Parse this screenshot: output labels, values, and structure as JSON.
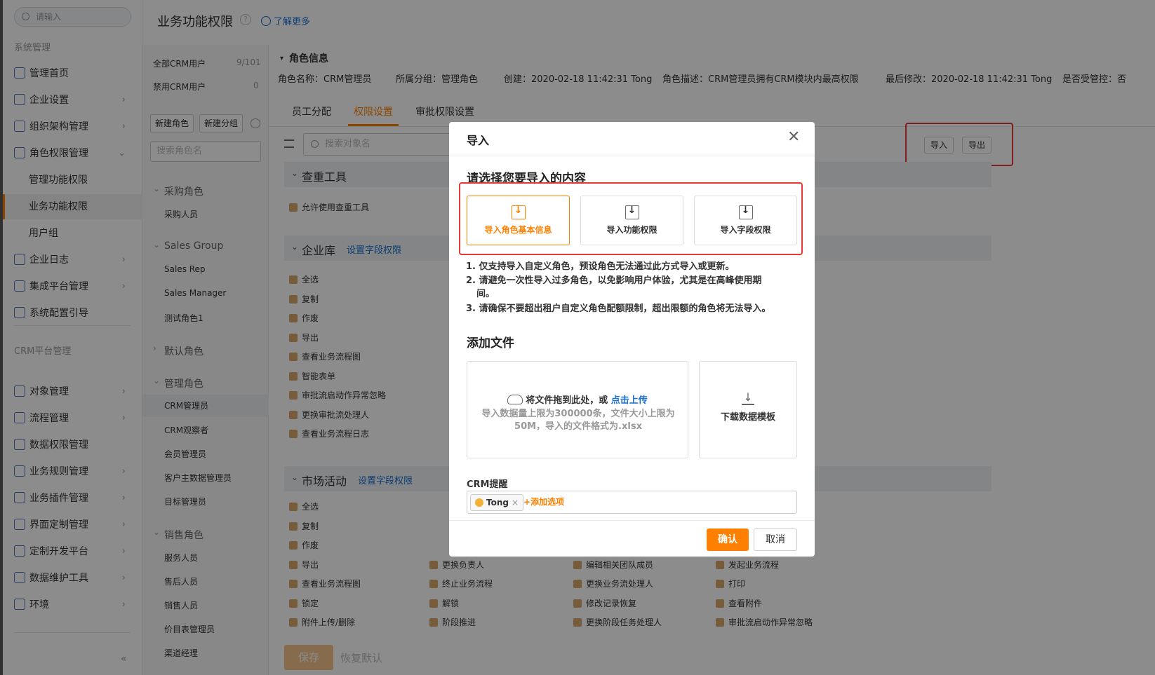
{
  "sidebar": {
    "search_placeholder": "请输入",
    "section1": "系统管理",
    "items1": [
      {
        "label": "管理首页",
        "icon": "home-icon",
        "arrow": ""
      },
      {
        "label": "企业设置",
        "icon": "building-icon",
        "arrow": "›"
      },
      {
        "label": "组织架构管理",
        "icon": "org-chart-icon",
        "arrow": "›"
      },
      {
        "label": "角色权限管理",
        "icon": "role-icon",
        "arrow": "⌄"
      }
    ],
    "subitems": [
      "管理功能权限",
      "业务功能权限",
      "用户组"
    ],
    "items2": [
      {
        "label": "企业日志",
        "icon": "log-icon",
        "arrow": "›"
      },
      {
        "label": "集成平台管理",
        "icon": "integration-icon",
        "arrow": "›"
      },
      {
        "label": "系统配置引导",
        "icon": "guide-icon",
        "arrow": ""
      }
    ],
    "section2": "CRM平台管理",
    "items3": [
      {
        "label": "对象管理",
        "icon": "object-icon",
        "arrow": "›"
      },
      {
        "label": "流程管理",
        "icon": "flow-icon",
        "arrow": "›"
      },
      {
        "label": "数据权限管理",
        "icon": "data-permission-icon",
        "arrow": ""
      },
      {
        "label": "业务规则管理",
        "icon": "rule-icon",
        "arrow": "›"
      },
      {
        "label": "业务插件管理",
        "icon": "plugin-icon",
        "arrow": "›"
      },
      {
        "label": "界面定制管理",
        "icon": "layout-icon",
        "arrow": "›"
      },
      {
        "label": "定制开发平台",
        "icon": "code-icon",
        "arrow": "›"
      },
      {
        "label": "数据维护工具",
        "icon": "chart-icon",
        "arrow": "›"
      },
      {
        "label": "环境",
        "icon": "env-icon",
        "arrow": "›"
      }
    ],
    "collapse": "«"
  },
  "header": {
    "title": "业务功能权限",
    "help": "?",
    "learn_more": "了解更多"
  },
  "col2": {
    "all_users": "全部CRM用户",
    "all_count": "9/101",
    "disabled_users": "禁用CRM用户",
    "disabled_count": "0",
    "new_role": "新建角色",
    "new_group": "新建分组",
    "search_placeholder": "搜索角色名",
    "groups": [
      {
        "name": "采购角色",
        "items": [
          "采购人员"
        ]
      },
      {
        "name": "Sales Group",
        "items": [
          "Sales Rep",
          "Sales Manager",
          "测试角色1"
        ]
      },
      {
        "name": "默认角色",
        "items": []
      },
      {
        "name": "管理角色",
        "items": [
          "CRM管理员",
          "CRM观察者",
          "会员管理员",
          "客户主数据管理员",
          "目标管理员"
        ]
      },
      {
        "name": "销售角色",
        "items": [
          "服务人员",
          "售后人员",
          "销售人员",
          "价目表管理员",
          "渠道经理"
        ]
      }
    ]
  },
  "role": {
    "title": "角色信息",
    "name": "角色名称：CRM管理员",
    "group": "所属分组：管理角色",
    "created": "创建：2020-02-18 11:42:31 Tong",
    "desc": "角色描述：CRM管理员拥有CRM模块内最高权限",
    "modified": "最后修改：2020-02-18 11:42:31 Tong",
    "controlled": "是否受管控：否"
  },
  "tabs": [
    "员工分配",
    "权限设置",
    "审批权限设置"
  ],
  "toolbar": {
    "search_placeholder": "搜索对象名",
    "import": "导入",
    "export": "导出"
  },
  "sections": [
    {
      "title": "查重工具",
      "link": "",
      "perms": [
        [
          "允许使用查重工具"
        ]
      ]
    },
    {
      "title": "企业库",
      "link": "设置字段权限",
      "perms": [
        [
          "全选",
          "复制",
          "作废",
          "导出",
          "查看业务流程图",
          "智能表单",
          "审批流启动作异常忽略",
          "更换审批流处理人",
          "查看业务流程日志"
        ]
      ]
    },
    {
      "title": "市场活动",
      "link": "设置字段权限",
      "perms": [
        [
          "全选",
          "复制",
          "作废",
          "导出",
          "查看业务流程图",
          "锁定",
          "附件上传/删除"
        ],
        [
          "更换负责人",
          "终止业务流程",
          "解锁",
          "阶段推进"
        ],
        [
          "编辑相关团队成员",
          "更换业务流处理人",
          "修改记录恢复",
          "更换阶段任务处理人"
        ],
        [
          "发起业务流程",
          "打印",
          "查看附件",
          "审批流启动作异常忽略"
        ]
      ]
    }
  ],
  "footer": {
    "save": "保存",
    "reset": "恢复默认"
  },
  "modal": {
    "title": "导入",
    "close": "✕",
    "choose_heading": "请选择您要导入的内容",
    "choices": [
      "导入角色基本信息",
      "导入功能权限",
      "导入字段权限"
    ],
    "notes": [
      "1. 仅支持导入自定义角色，预设角色无法通过此方式导入或更新。",
      "2. 请避免一次性导入过多角色，以免影响用户体验，尤其是在高峰使用期",
      "间。",
      "3. 请确保不要超出租户自定义角色配额限制，超出限额的角色将无法导入。"
    ],
    "add_file_heading": "添加文件",
    "upload_text": "将文件拖到此处，或",
    "upload_link": "点击上传",
    "upload_limit": "导入数据量上限为300000条，文件大小上限为50M，导入的文件格式为.xlsx",
    "download_template": "下载数据模板",
    "crm_label": "CRM提醒",
    "tag": "Tong",
    "tag_remove": "×",
    "add_option": "+添加选项",
    "ok": "确认",
    "cancel": "取消"
  },
  "colors": {
    "accent": "#ff8000",
    "link": "#1a6fd1",
    "highlight": "#e53935"
  }
}
